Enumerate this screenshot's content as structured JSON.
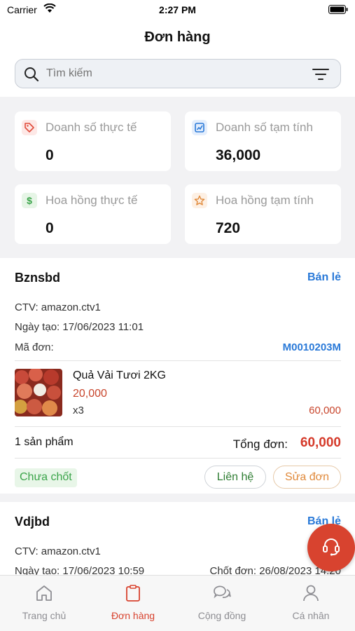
{
  "status_bar": {
    "carrier": "Carrier",
    "time": "2:27 PM"
  },
  "header": {
    "title": "Đơn hàng"
  },
  "search": {
    "placeholder": "Tìm kiếm"
  },
  "stats": [
    {
      "label": "Doanh số thực tế",
      "value": "0",
      "icon": "tag-icon",
      "color": "#e04a3a"
    },
    {
      "label": "Doanh số tạm tính",
      "value": "36,000",
      "icon": "chart-icon",
      "color": "#2979d8"
    },
    {
      "label": "Hoa hồng thực tế",
      "value": "0",
      "icon": "dollar-icon",
      "color": "#3ba44a"
    },
    {
      "label": "Hoa hồng tạm tính",
      "value": "720",
      "icon": "star-icon",
      "color": "#e0893a"
    }
  ],
  "orders": [
    {
      "name": "Bznsbd",
      "type": "Bán lẻ",
      "ctv": "CTV: amazon.ctv1",
      "created": "Ngày tạo: 17/06/2023 11:01",
      "code_label": "Mã đơn:",
      "code": "M0010203M",
      "product": {
        "name": "Quả Vải Tươi 2KG",
        "price": "20,000",
        "qty": "x3",
        "subtotal": "60,000"
      },
      "count": "1 sản phẩm",
      "total_label": "Tổng đơn:",
      "total": "60,000",
      "status": "Chưa chốt",
      "contact_label": "Liên hệ",
      "edit_label": "Sửa đơn"
    },
    {
      "name": "Vdjbd",
      "type": "Bán lẻ",
      "ctv": "CTV: amazon.ctv1",
      "created": "Ngày tạo: 17/06/2023 10:59",
      "closed": "Chốt đơn: 26/08/2023 14:20"
    }
  ],
  "tabs": [
    {
      "label": "Trang chủ",
      "icon": "home-icon",
      "active": false
    },
    {
      "label": "Đơn hàng",
      "icon": "clipboard-icon",
      "active": true
    },
    {
      "label": "Cộng đồng",
      "icon": "chat-icon",
      "active": false
    },
    {
      "label": "Cá nhân",
      "icon": "user-icon",
      "active": false
    }
  ],
  "colors": {
    "accent": "#d8432f",
    "link": "#2979d8",
    "price": "#c8452c",
    "status": "#3ba44a"
  }
}
